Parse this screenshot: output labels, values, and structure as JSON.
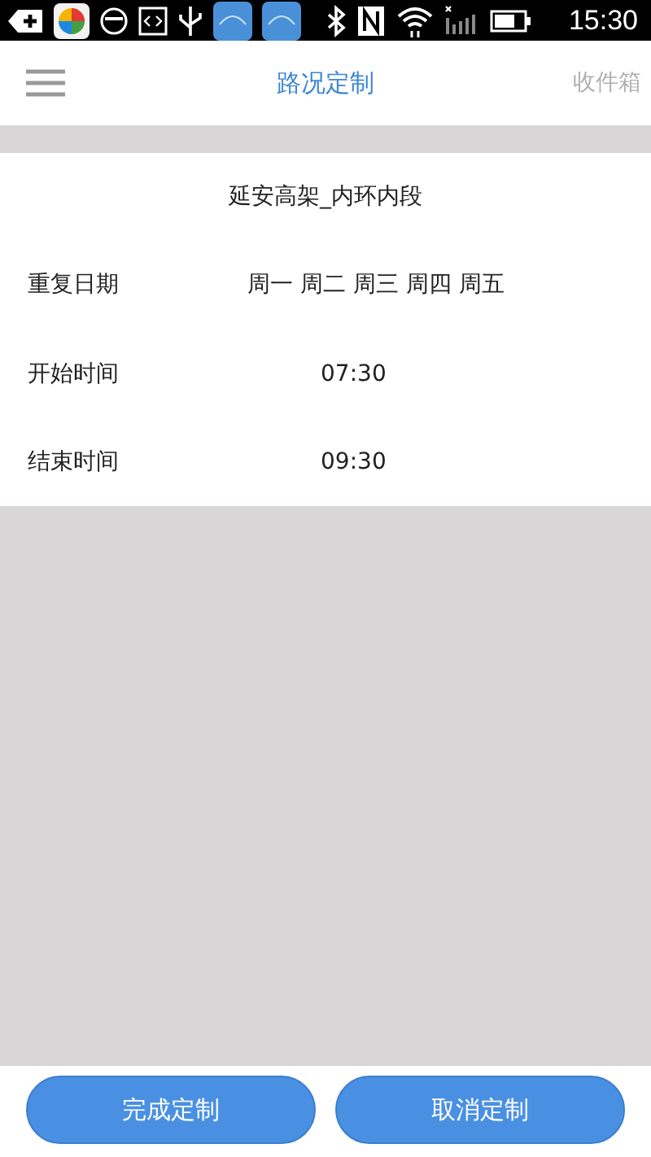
{
  "status_bar": {
    "time": "15:30"
  },
  "header": {
    "title": "路况定制",
    "action": "收件箱"
  },
  "route": {
    "name": "延安高架_内环内段"
  },
  "fields": [
    {
      "label": "重复日期",
      "value": "周一 周二 周三 周四 周五"
    },
    {
      "label": "开始时间",
      "value": "07:30"
    },
    {
      "label": "结束时间",
      "value": "09:30"
    }
  ],
  "buttons": [
    "完成定制",
    "取消定制"
  ]
}
